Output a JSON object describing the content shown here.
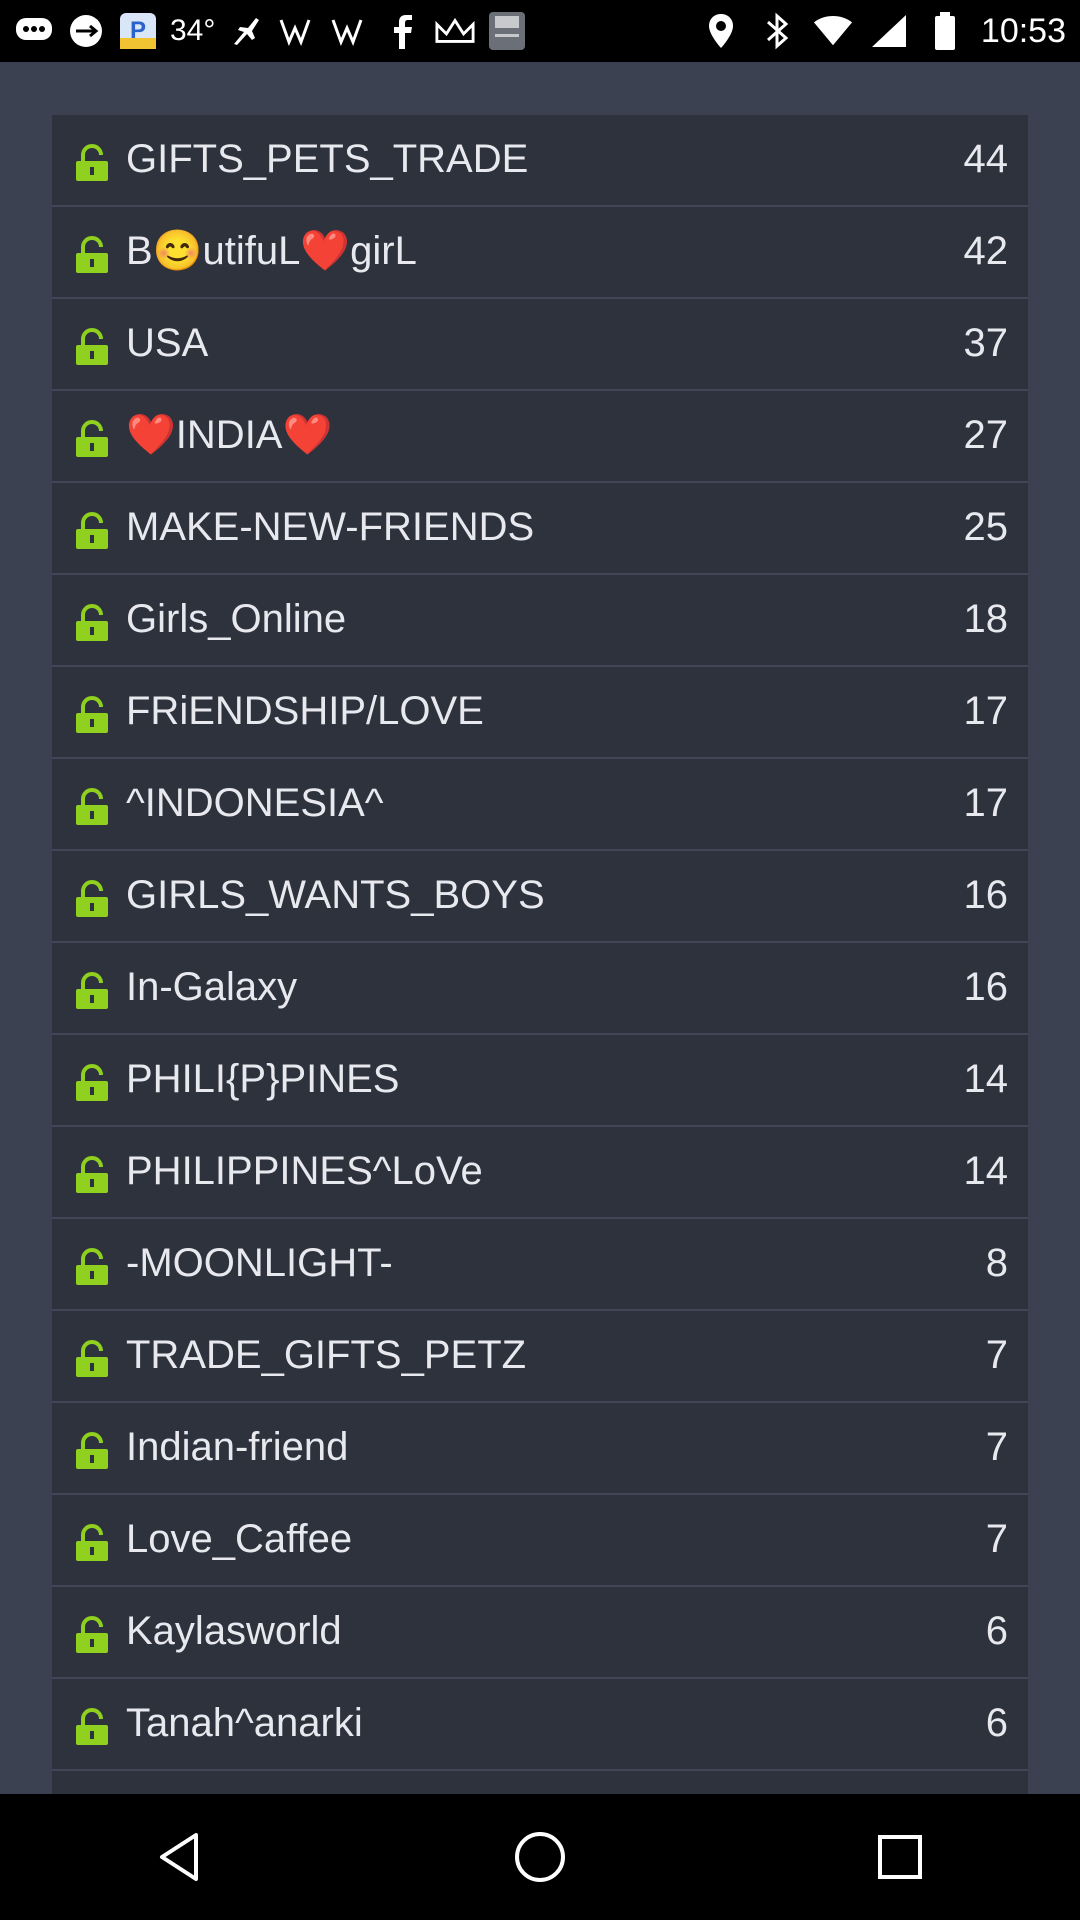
{
  "status_bar": {
    "temperature": "34°",
    "time": "10:53",
    "left_icons": [
      "chat-icon",
      "usb-icon",
      "p-app-icon",
      "temperature",
      "airplane-icon",
      "signal-icon",
      "signal-icon",
      "facebook-icon",
      "crown-icon",
      "bible-app-icon"
    ],
    "right_icons": [
      "location-icon",
      "bluetooth-icon",
      "wifi-icon",
      "cellular-signal-icon",
      "battery-icon"
    ]
  },
  "colors": {
    "background": "#3b4150",
    "row_background": "#2e323d",
    "lock_icon": "#8fd11e",
    "text": "#e8e9ee"
  },
  "rooms": [
    {
      "name": "GIFTS_PETS_TRADE",
      "count": "44"
    },
    {
      "name": "B😊utifuL❤️girL",
      "count": "42"
    },
    {
      "name": "USA",
      "count": "37"
    },
    {
      "name": "❤️INDIA❤️",
      "count": "27"
    },
    {
      "name": "MAKE-NEW-FRIENDS",
      "count": "25"
    },
    {
      "name": "Girls_Online",
      "count": "18"
    },
    {
      "name": "FRiENDSHIP/LOVE",
      "count": "17"
    },
    {
      "name": "^INDONESIA^",
      "count": "17"
    },
    {
      "name": "GIRLS_WANTS_BOYS",
      "count": "16"
    },
    {
      "name": "In-Galaxy",
      "count": "16"
    },
    {
      "name": "PHILI{P}PINES",
      "count": "14"
    },
    {
      "name": "PHILIPPINES^LoVe",
      "count": "14"
    },
    {
      "name": "-MOONLIGHT-",
      "count": "8"
    },
    {
      "name": "TRADE_GIFTS_PETZ",
      "count": "7"
    },
    {
      "name": "Indian-friend",
      "count": "7"
    },
    {
      "name": "Love_Caffee",
      "count": "7"
    },
    {
      "name": "Kaylasworld",
      "count": "6"
    },
    {
      "name": "Tanah^anarki",
      "count": "6"
    }
  ],
  "nav": {
    "back": "back-icon",
    "home": "home-icon",
    "recents": "recents-icon"
  }
}
